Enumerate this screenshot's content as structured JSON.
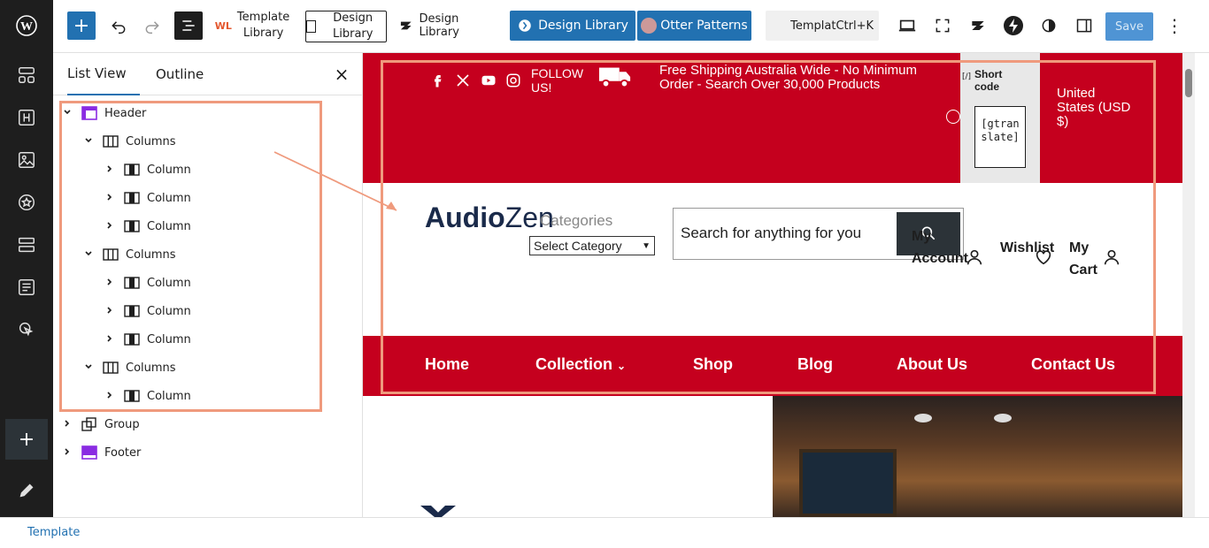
{
  "toolbar": {
    "template_library_label": "Template Library",
    "design_library_outline_label": "Design Library",
    "design_library_label": "Design Library",
    "design_library_blue_label": "Design Library",
    "otter_label": "Otter Patterns",
    "command_label": "TemplatCtrl+K",
    "save_label": "Save"
  },
  "panel": {
    "tabs": [
      {
        "label": "List View"
      },
      {
        "label": "Outline"
      }
    ],
    "tree": [
      {
        "label": "Header"
      },
      {
        "label": "Columns"
      },
      {
        "label": "Column"
      },
      {
        "label": "Column"
      },
      {
        "label": "Column"
      },
      {
        "label": "Columns"
      },
      {
        "label": "Column"
      },
      {
        "label": "Column"
      },
      {
        "label": "Column"
      },
      {
        "label": "Columns"
      },
      {
        "label": "Column"
      },
      {
        "label": "Group"
      },
      {
        "label": "Footer"
      }
    ]
  },
  "canvas": {
    "follow_text": "FOLLOW US!",
    "shipping_text": "Free Shipping Australia Wide - No Minimum Order - Search Over 30,000 Products",
    "shortcode_label": "Short code",
    "shortcode_value": "[gtranslate]",
    "currency": "United States (USD $)",
    "logo_bold": "Audio",
    "logo_light": "Zen",
    "categories_label": "Categories",
    "select_value": "Select Category",
    "search_placeholder": "Search for anything for you",
    "account_label": "My Account",
    "wishlist_label": "Wishlist",
    "cart_label": "My Cart",
    "nav": [
      {
        "label": "Home"
      },
      {
        "label": "Collection"
      },
      {
        "label": "Shop"
      },
      {
        "label": "Blog"
      },
      {
        "label": "About Us"
      },
      {
        "label": "Contact Us"
      }
    ]
  },
  "footer": {
    "breadcrumb": "Template"
  },
  "colors": {
    "accent": "#2271b1",
    "brand_red": "#c5001e",
    "highlight": "#ef9a7d"
  }
}
